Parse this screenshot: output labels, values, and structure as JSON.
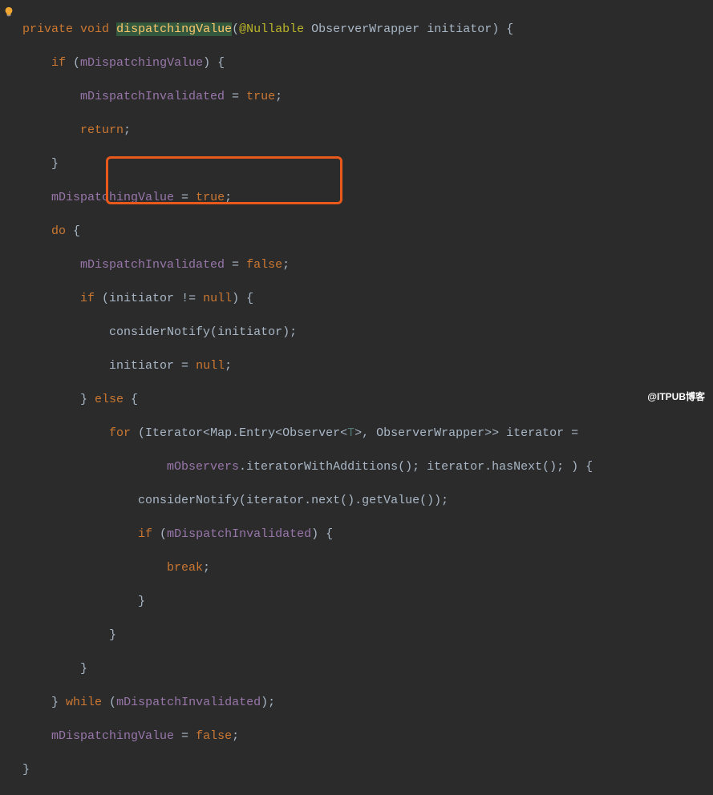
{
  "code": {
    "l1_private": "private",
    "l1_void": "void",
    "l1_method": "dispatchingValue",
    "l1_paren_open": "(",
    "l1_annotation": "@Nullable",
    "l1_param_type": "ObserverWrapper",
    "l1_param_name": "initiator",
    "l1_paren_close": ") {",
    "l2_if": "if",
    "l2_cond_open": " (",
    "l2_field": "mDispatchingValue",
    "l2_cond_close": ") {",
    "l3_field": "mDispatchInvalidated",
    "l3_assign": " = ",
    "l3_true": "true",
    "l3_semi": ";",
    "l4_return": "return",
    "l4_semi": ";",
    "l5_brace": "}",
    "l6_field": "mDispatchingValue",
    "l6_assign": " = ",
    "l6_true": "true",
    "l6_semi": ";",
    "l7_do": "do",
    "l7_brace": " {",
    "l8_field": "mDispatchInvalidated",
    "l8_assign": " = ",
    "l8_false": "false",
    "l8_semi": ";",
    "l9_if": "if",
    "l9_open": " (",
    "l9_var": "initiator",
    "l9_ne": " != ",
    "l9_null": "null",
    "l9_close": ") {",
    "l10_call": "considerNotify(",
    "l10_arg": "initiator",
    "l10_close": ");",
    "l11_var": "initiator",
    "l11_assign": " = ",
    "l11_null": "null",
    "l11_semi": ";",
    "l12_brace": "}",
    "l12_else": " else ",
    "l12_open": "{",
    "l13_for": "for",
    "l13_open": " (Iterator<Map.Entry<Observer<",
    "l13_t": "T",
    "l13_mid": ">, ObserverWrapper>> iterator =",
    "l14_field": "mObservers",
    "l14_call": ".iteratorWithAdditions(); iterator.hasNext(); ) {",
    "l15_text": "considerNotify(iterator.next().getValue());",
    "l16_if": "if",
    "l16_open": " (",
    "l16_field": "mDispatchInvalidated",
    "l16_close": ") {",
    "l17_break": "break",
    "l17_semi": ";",
    "l18_brace": "}",
    "l19_brace": "}",
    "l20_brace": "}",
    "l21_brace": "}",
    "l21_while": " while ",
    "l21_open": "(",
    "l21_field": "mDispatchInvalidated",
    "l21_close": ");",
    "l22_field": "mDispatchingValue",
    "l22_assign": " = ",
    "l22_false": "false",
    "l22_semi": ";",
    "l23_brace": "}"
  },
  "watermark": "@ITPUB博客"
}
